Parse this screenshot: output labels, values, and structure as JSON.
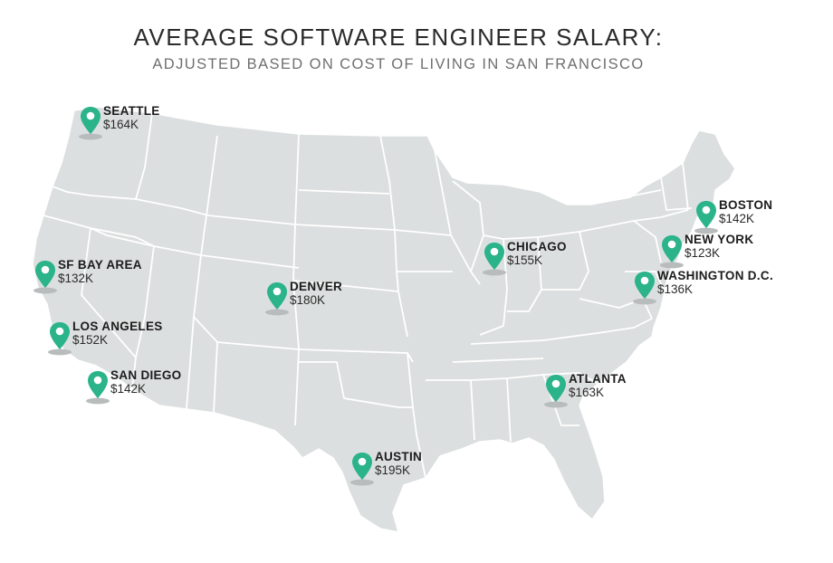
{
  "header": {
    "title": "AVERAGE SOFTWARE ENGINEER SALARY:",
    "subtitle": "ADJUSTED BASED ON COST OF LIVING IN SAN FRANCISCO"
  },
  "colors": {
    "map_fill": "#dcdfdf",
    "state_border": "#ffffff",
    "pin": "#2bb38a",
    "pin_shadow": "#b9bcbc"
  },
  "cities": [
    {
      "name": "SEATTLE",
      "salary": "$164K"
    },
    {
      "name": "SF BAY AREA",
      "salary": "$132K"
    },
    {
      "name": "LOS ANGELES",
      "salary": "$152K"
    },
    {
      "name": "SAN DIEGO",
      "salary": "$142K"
    },
    {
      "name": "DENVER",
      "salary": "$180K"
    },
    {
      "name": "AUSTIN",
      "salary": "$195K"
    },
    {
      "name": "CHICAGO",
      "salary": "$155K"
    },
    {
      "name": "ATLANTA",
      "salary": "$163K"
    },
    {
      "name": "BOSTON",
      "salary": "$142K"
    },
    {
      "name": "NEW YORK",
      "salary": "$123K"
    },
    {
      "name": "WASHINGTON  D.C.",
      "salary": "$136K"
    }
  ]
}
